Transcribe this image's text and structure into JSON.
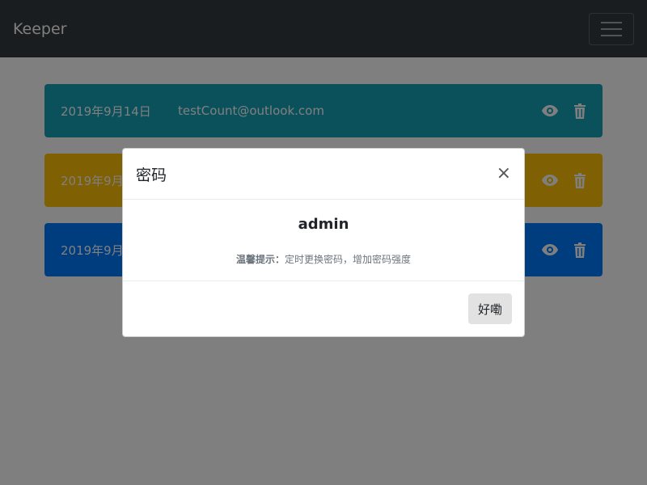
{
  "navbar": {
    "brand": "Keeper"
  },
  "entries": [
    {
      "date": "2019年9月14日",
      "account": "testCount@outlook.com",
      "color": "#17a2b8"
    },
    {
      "date": "2019年9月",
      "account": "",
      "color": "#ffc107"
    },
    {
      "date": "2019年9月",
      "account": "",
      "color": "#007bff"
    }
  ],
  "modal": {
    "title": "密码",
    "close_glyph": "×",
    "secret": "admin",
    "hint_label": "温馨提示：",
    "hint_text": "定时更换密码，增加密码强度",
    "ok_label": "好嘞"
  },
  "icons": {
    "menu": "hamburger-menu-icon",
    "view": "eye-icon",
    "delete": "trash-icon"
  }
}
